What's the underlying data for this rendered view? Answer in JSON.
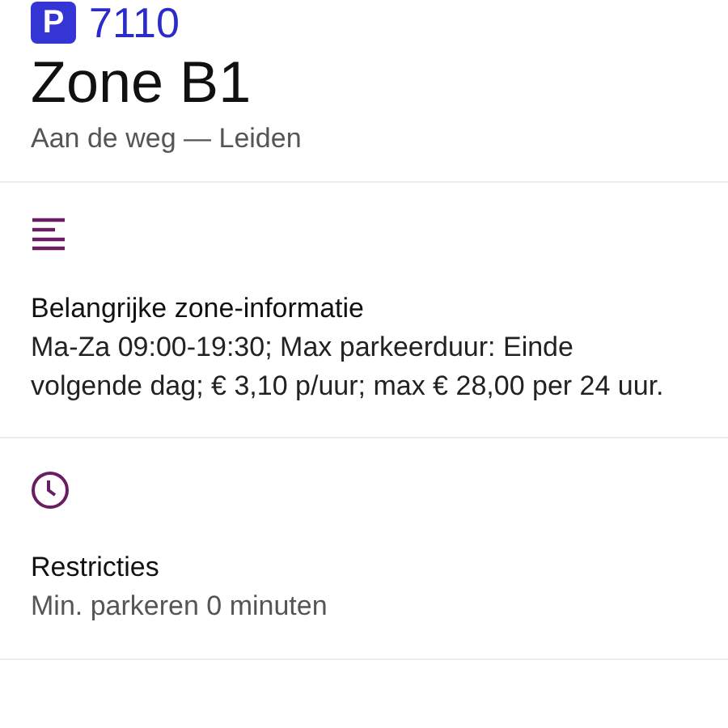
{
  "header": {
    "badge": "P",
    "code": "7110",
    "title": "Zone B1",
    "subtitle": "Aan de weg — Leiden"
  },
  "sections": [
    {
      "kind": "lines",
      "heading": "Belangrijke zone-informatie",
      "text": "Ma-Za 09:00-19:30; Max parkeerduur: Einde volgende dag; € 3,10 p/uur; max € 28,00 per 24 uur."
    },
    {
      "kind": "clock",
      "heading": "Restricties",
      "text": "Min. parkeren 0 minuten"
    }
  ]
}
